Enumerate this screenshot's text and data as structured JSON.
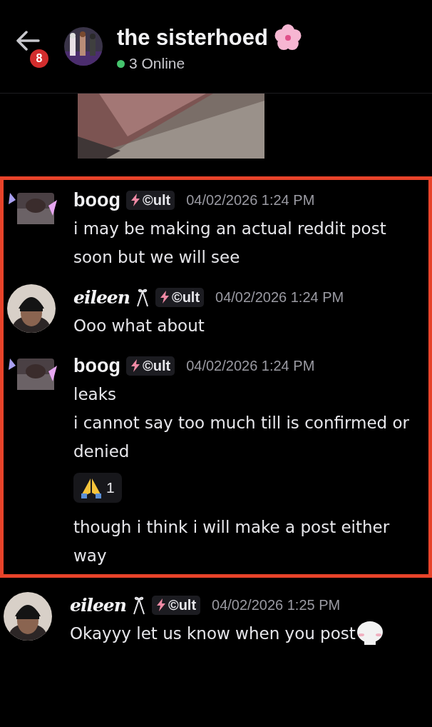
{
  "header": {
    "title": "the sisterhoed",
    "status": "3 Online",
    "unread_badge": "8"
  },
  "messages": [
    {
      "author": "boog",
      "kind": "plain",
      "tag": "©ult",
      "timestamp": "04/02/2026 1:24 PM",
      "highlighted": true,
      "content": [
        {
          "kind": "text",
          "text": "i may be making an actual reddit post soon but we will see"
        }
      ]
    },
    {
      "author": "eileen",
      "kind": "fancy",
      "tag": "©ult",
      "timestamp": "04/02/2026 1:24 PM",
      "highlighted": true,
      "content": [
        {
          "kind": "text",
          "text": "Ooo what about"
        }
      ]
    },
    {
      "author": "boog",
      "kind": "plain",
      "tag": "©ult",
      "timestamp": "04/02/2026 1:24 PM",
      "highlighted": true,
      "content": [
        {
          "kind": "text",
          "text": "leaks"
        },
        {
          "kind": "text",
          "text": "i cannot say too much till is confirmed or denied"
        },
        {
          "kind": "reaction",
          "count": "1"
        },
        {
          "kind": "text",
          "text": "though i think i will make a post either way"
        }
      ]
    },
    {
      "author": "eileen",
      "kind": "fancy",
      "tag": "©ult",
      "timestamp": "04/02/2026 1:25 PM",
      "highlighted": false,
      "content": [
        {
          "kind": "text_sticker",
          "text": "Okayyy let us know when you post"
        }
      ]
    }
  ]
}
